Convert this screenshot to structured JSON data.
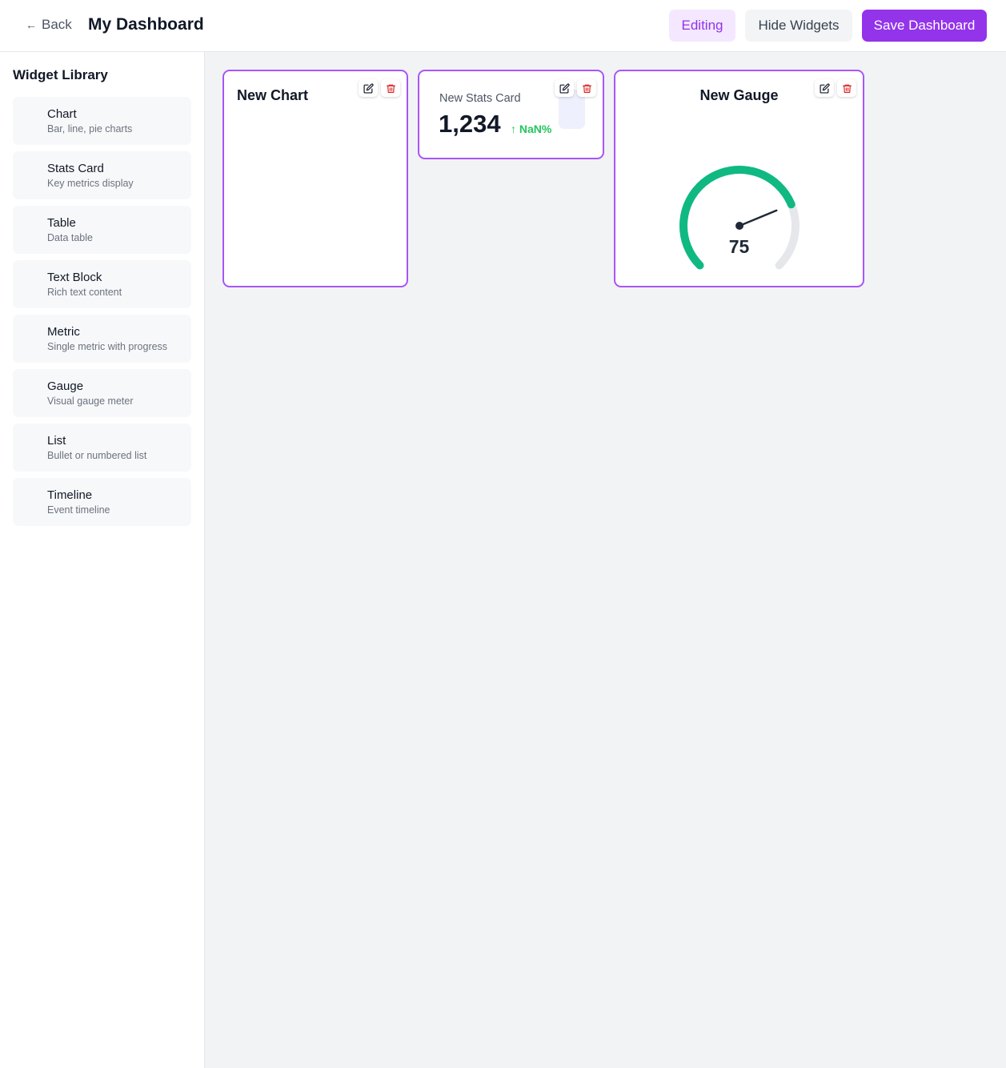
{
  "header": {
    "back_label": "Back",
    "back_arrow": "←",
    "title": "My Dashboard",
    "editing_label": "Editing",
    "hide_label": "Hide Widgets",
    "save_label": "Save Dashboard"
  },
  "sidebar": {
    "title": "Widget Library",
    "items": [
      {
        "name": "Chart",
        "desc": "Bar, line, pie charts"
      },
      {
        "name": "Stats Card",
        "desc": "Key metrics display"
      },
      {
        "name": "Table",
        "desc": "Data table"
      },
      {
        "name": "Text Block",
        "desc": "Rich text content"
      },
      {
        "name": "Metric",
        "desc": "Single metric with progress"
      },
      {
        "name": "Gauge",
        "desc": "Visual gauge meter"
      },
      {
        "name": "List",
        "desc": "Bullet or numbered list"
      },
      {
        "name": "Timeline",
        "desc": "Event timeline"
      }
    ]
  },
  "widgets": {
    "chart": {
      "title": "New Chart"
    },
    "stats": {
      "label": "New Stats Card",
      "value": "1,234",
      "change": "↑ NaN%"
    },
    "gauge": {
      "title": "New Gauge",
      "value": "75",
      "value_num": 75,
      "max": 100
    }
  },
  "colors": {
    "accent": "#9333ea",
    "gauge_fill": "#10b981",
    "gauge_track": "#e5e7eb",
    "positive": "#22c55e",
    "delete": "#dc2626"
  },
  "icons": {
    "edit": "pencil-square-icon",
    "delete": "trash-icon"
  }
}
